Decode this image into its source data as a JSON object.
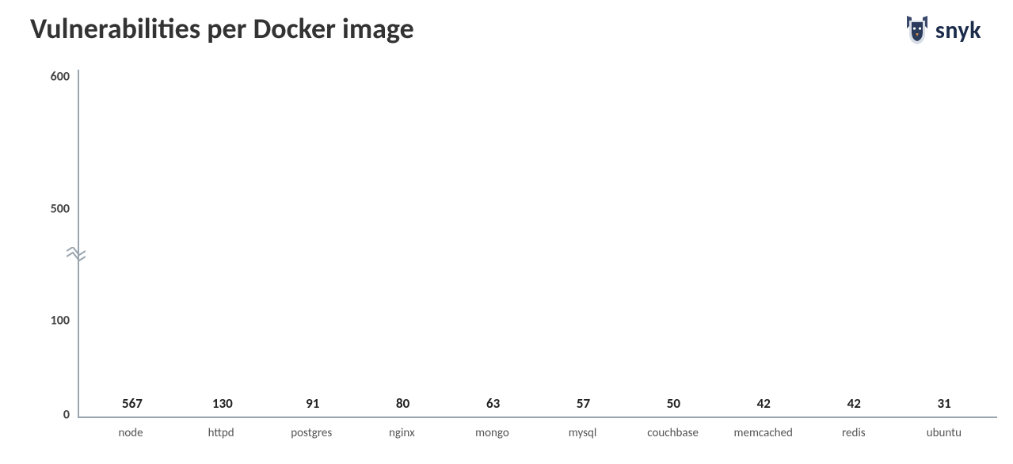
{
  "title": "Vulnerabilities per Docker image",
  "logo_text": "snyk",
  "y_ticks": [
    "600",
    "500",
    "100",
    "0"
  ],
  "chart_data": {
    "type": "bar",
    "title": "Vulnerabilities per Docker image",
    "xlabel": "",
    "ylabel": "",
    "ylim": [
      0,
      600
    ],
    "axis_break": true,
    "categories": [
      "node",
      "httpd",
      "postgres",
      "nginx",
      "mongo",
      "mysql",
      "couchbase",
      "memcached",
      "redis",
      "ubuntu"
    ],
    "values": [
      567,
      130,
      91,
      80,
      63,
      57,
      50,
      42,
      42,
      31
    ]
  }
}
